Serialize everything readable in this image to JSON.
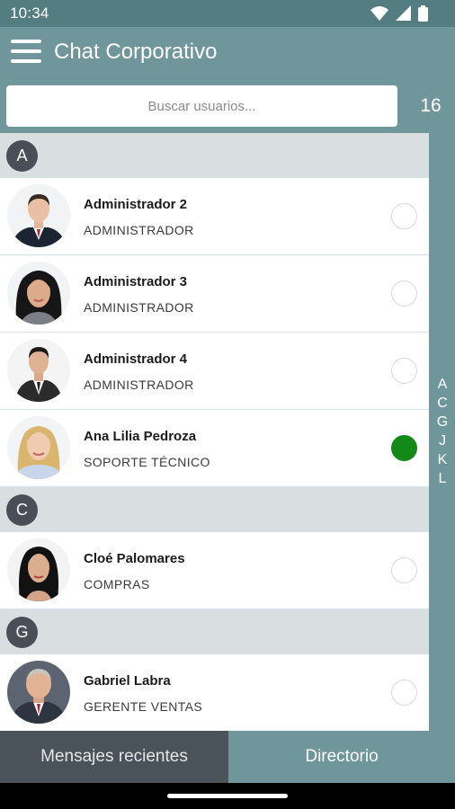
{
  "status_bar": {
    "time": "10:34"
  },
  "app_bar": {
    "title": "Chat Corporativo"
  },
  "search": {
    "placeholder": "Buscar usuarios...",
    "count": "16"
  },
  "sections": [
    {
      "letter": "A",
      "contacts": [
        {
          "name": "Administrador 2",
          "role": "ADMINISTRADOR",
          "online": false
        },
        {
          "name": "Administrador 3",
          "role": "ADMINISTRADOR",
          "online": false
        },
        {
          "name": "Administrador 4",
          "role": "ADMINISTRADOR",
          "online": false
        },
        {
          "name": "Ana Lilia Pedroza",
          "role": "SOPORTE TÉCNICO",
          "online": true
        }
      ]
    },
    {
      "letter": "C",
      "contacts": [
        {
          "name": "Cloé Palomares",
          "role": "COMPRAS",
          "online": false
        }
      ]
    },
    {
      "letter": "G",
      "contacts": [
        {
          "name": "Gabriel Labra",
          "role": "GERENTE VENTAS",
          "online": false
        }
      ]
    }
  ],
  "alpha_index": [
    "A",
    "C",
    "G",
    "J",
    "K",
    "L"
  ],
  "bottom_nav": {
    "recent": "Mensajes recientes",
    "directory": "Directorio"
  },
  "colors": {
    "app_bar": "#6f969b",
    "status_bar": "#547d82",
    "section_bg": "#d9dfe1",
    "online": "#13891a",
    "active_tab": "#4a525a"
  }
}
